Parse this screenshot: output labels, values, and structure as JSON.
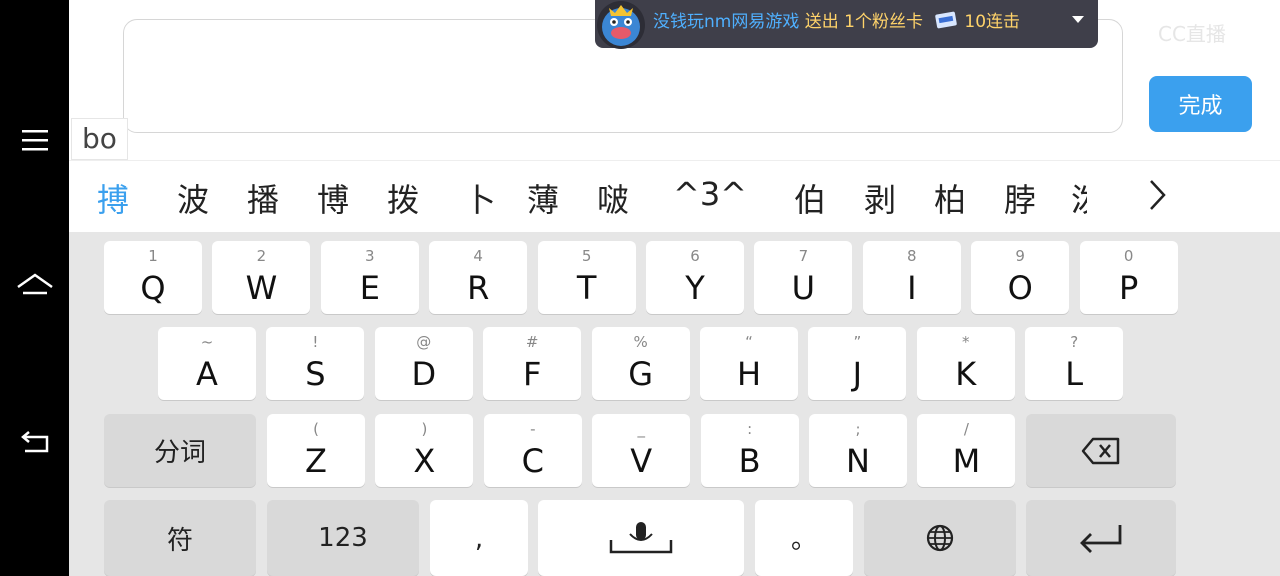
{
  "input": {
    "pinyin": "bo",
    "done_label": "完成"
  },
  "banner": {
    "user": "没钱玩nm网易游戏",
    "action": " 送出 1个粉丝卡",
    "suffix": "10连击"
  },
  "watermark": "CC直播",
  "candidates": {
    "items": [
      "搏",
      "波",
      "播",
      "博",
      "拨",
      "卜",
      "薄",
      "啵",
      "^3^",
      "伯",
      "剥",
      "柏",
      "脖",
      "泼"
    ],
    "active_index": 0
  },
  "keyboard": {
    "row1": [
      {
        "main": "Q",
        "sub": "1"
      },
      {
        "main": "W",
        "sub": "2"
      },
      {
        "main": "E",
        "sub": "3"
      },
      {
        "main": "R",
        "sub": "4"
      },
      {
        "main": "T",
        "sub": "5"
      },
      {
        "main": "Y",
        "sub": "6"
      },
      {
        "main": "U",
        "sub": "7"
      },
      {
        "main": "I",
        "sub": "8"
      },
      {
        "main": "O",
        "sub": "9"
      },
      {
        "main": "P",
        "sub": "0"
      }
    ],
    "row2": [
      {
        "main": "A",
        "sub": "~"
      },
      {
        "main": "S",
        "sub": "!"
      },
      {
        "main": "D",
        "sub": "@"
      },
      {
        "main": "F",
        "sub": "#"
      },
      {
        "main": "G",
        "sub": "%"
      },
      {
        "main": "H",
        "sub": "“"
      },
      {
        "main": "J",
        "sub": "”"
      },
      {
        "main": "K",
        "sub": "*"
      },
      {
        "main": "L",
        "sub": "?"
      }
    ],
    "row3": [
      {
        "main": "Z",
        "sub": "("
      },
      {
        "main": "X",
        "sub": ")"
      },
      {
        "main": "C",
        "sub": "-"
      },
      {
        "main": "V",
        "sub": "_"
      },
      {
        "main": "B",
        "sub": ":"
      },
      {
        "main": "N",
        "sub": ";"
      },
      {
        "main": "M",
        "sub": "/"
      }
    ],
    "segment_label": "分词",
    "symbol_label": "符",
    "number_label": "123",
    "comma_label": ",",
    "period_label": "。"
  }
}
